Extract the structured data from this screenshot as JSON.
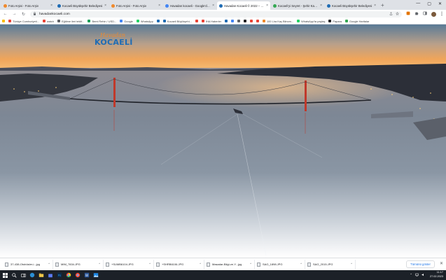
{
  "tabs": [
    {
      "title": "Foto Arşivi - Foto Arşiv",
      "favicon_color": "#f08a2c",
      "active": false
    },
    {
      "title": "Kocaeli Büyükşehir Belediyesi",
      "favicon_color": "#1f6cb4",
      "active": false
    },
    {
      "title": "Foto Arşivi - Foto Arşiv",
      "favicon_color": "#f08a2c",
      "active": false
    },
    {
      "title": "Havadan kocaeli - Google'da Ara",
      "favicon_color": "#4285f4",
      "active": false
    },
    {
      "title": "Havadan Kocaeli © 2022 – Havadan",
      "favicon_color": "#1f6cb4",
      "active": true
    },
    {
      "title": "Kocaeli'yi Seyret - Şehir Kamerası",
      "favicon_color": "#34a853",
      "active": false
    },
    {
      "title": "Kocaeli Büyükşehir Belediyesi",
      "favicon_color": "#1f6cb4",
      "active": false
    }
  ],
  "new_tab_glyph": "+",
  "window_controls": [
    "—",
    "▢",
    "✕"
  ],
  "toolbar": {
    "back": "←",
    "forward": "→",
    "reload": "↻",
    "url": "havadankocaeli.com",
    "lock_glyph": "🔒"
  },
  "bookmarks": [
    {
      "label": "",
      "color": "#fbbc04"
    },
    {
      "label": "Türkiye Cumhuriyeti...",
      "color": "#ea4335"
    },
    {
      "label": "watch",
      "color": "#ea4335"
    },
    {
      "label": "Eğitime ileri teklif...",
      "color": "#5f6368"
    },
    {
      "label": "Bemi Rehin / USD...",
      "color": "#0f9d58"
    },
    {
      "label": "Google",
      "color": "#4285f4"
    },
    {
      "label": "WhatsApp",
      "color": "#25d366"
    },
    {
      "label": "",
      "color": "#1f6cb4"
    },
    {
      "label": "Kocaeli Büyükşehi...",
      "color": "#1f6cb4"
    },
    {
      "label": "",
      "color": "#ea4335"
    },
    {
      "label": "İHA Haberler",
      "color": "#ea4335"
    },
    {
      "label": "",
      "color": "#1f6cb4"
    },
    {
      "label": "",
      "color": "#4285f4"
    },
    {
      "label": "",
      "color": "#5f6368"
    },
    {
      "label": "",
      "color": "#202124"
    },
    {
      "label": "",
      "color": "#ea4335"
    },
    {
      "label": "",
      "color": "#ea4335"
    },
    {
      "label": "100 Lira Kaç Biinom...",
      "color": "#f08a2c"
    },
    {
      "label": "WhatsApp'ta paylaş",
      "color": "#25d366"
    },
    {
      "label": "Papara",
      "color": "#202124"
    },
    {
      "label": "Google Haritalar",
      "color": "#34a853"
    }
  ],
  "logo": {
    "line1": "Havadan",
    "line2": "KOCAELİ"
  },
  "downloads": [
    {
      "name": "37-438-Otobüsler-i...jpg"
    },
    {
      "name": "MIM_7834.JPG"
    },
    {
      "name": "+SUMB6104.JPG"
    },
    {
      "name": "+SHRB6106.JPG"
    },
    {
      "name": "Masadar-Bilgi-ve-Y...jpg"
    },
    {
      "name": "SAG_1898.JPG"
    },
    {
      "name": "SAG_2015.JPG"
    }
  ],
  "downloads_show_all": "Tümünü göster",
  "taskbar": {
    "time": "11:17",
    "date": "27.02.2023"
  },
  "colors": {
    "tab_strip": "#dee1e6",
    "taskbar": "#1c2128",
    "link_blue": "#1a73e8"
  }
}
